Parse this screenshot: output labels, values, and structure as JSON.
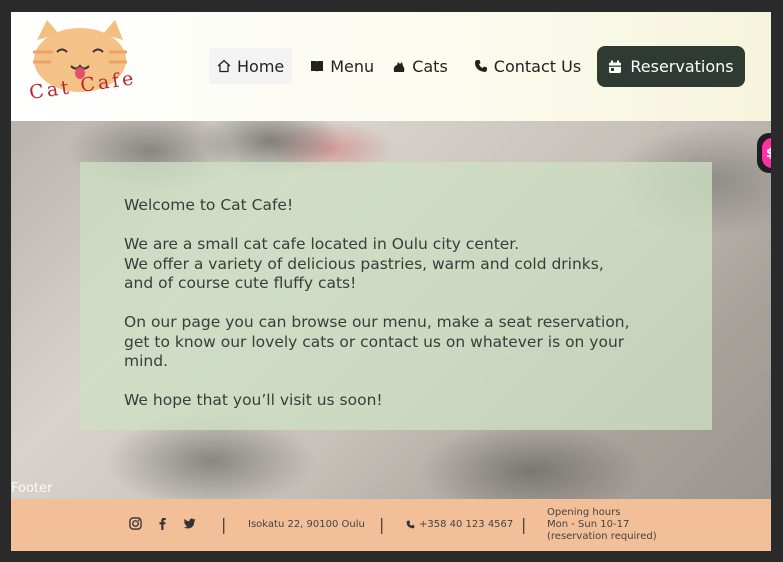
{
  "header": {
    "logo_text": "Cat Cafe",
    "nav": [
      {
        "label": "Home",
        "icon": "home-icon"
      },
      {
        "label": "Menu",
        "icon": "book-icon"
      },
      {
        "label": "Cats",
        "icon": "cat-icon"
      },
      {
        "label": "Contact Us",
        "icon": "phone-icon"
      }
    ],
    "reservations_label": "Reservations"
  },
  "hero": {
    "lines": [
      "Welcome to Cat Cafe!",
      "We are a small cat cafe located in Oulu city center.",
      "We offer a variety of delicious pastries, warm and cold drinks,",
      "and of course cute fluffy cats!",
      "On our page you can browse our menu, make a seat reservation,",
      "get to know our lovely cats or contact us on whatever is on your mind.",
      "We hope that you’ll visit us soon!"
    ],
    "footer_label": "Footer",
    "badge_text": "$"
  },
  "footer": {
    "separator": "|",
    "address": "Isokatu 22, 90100 Oulu",
    "phone": "+358 40 123 4567",
    "hours_title": "Opening hours",
    "hours_days": "Mon - Sun 10-17",
    "hours_note": "(reservation required)"
  },
  "colors": {
    "accent_dark": "#2f3b32",
    "footer_bg": "#f2bf98",
    "welcome_box": "#cee0c3",
    "logo_red": "#b8262b"
  }
}
